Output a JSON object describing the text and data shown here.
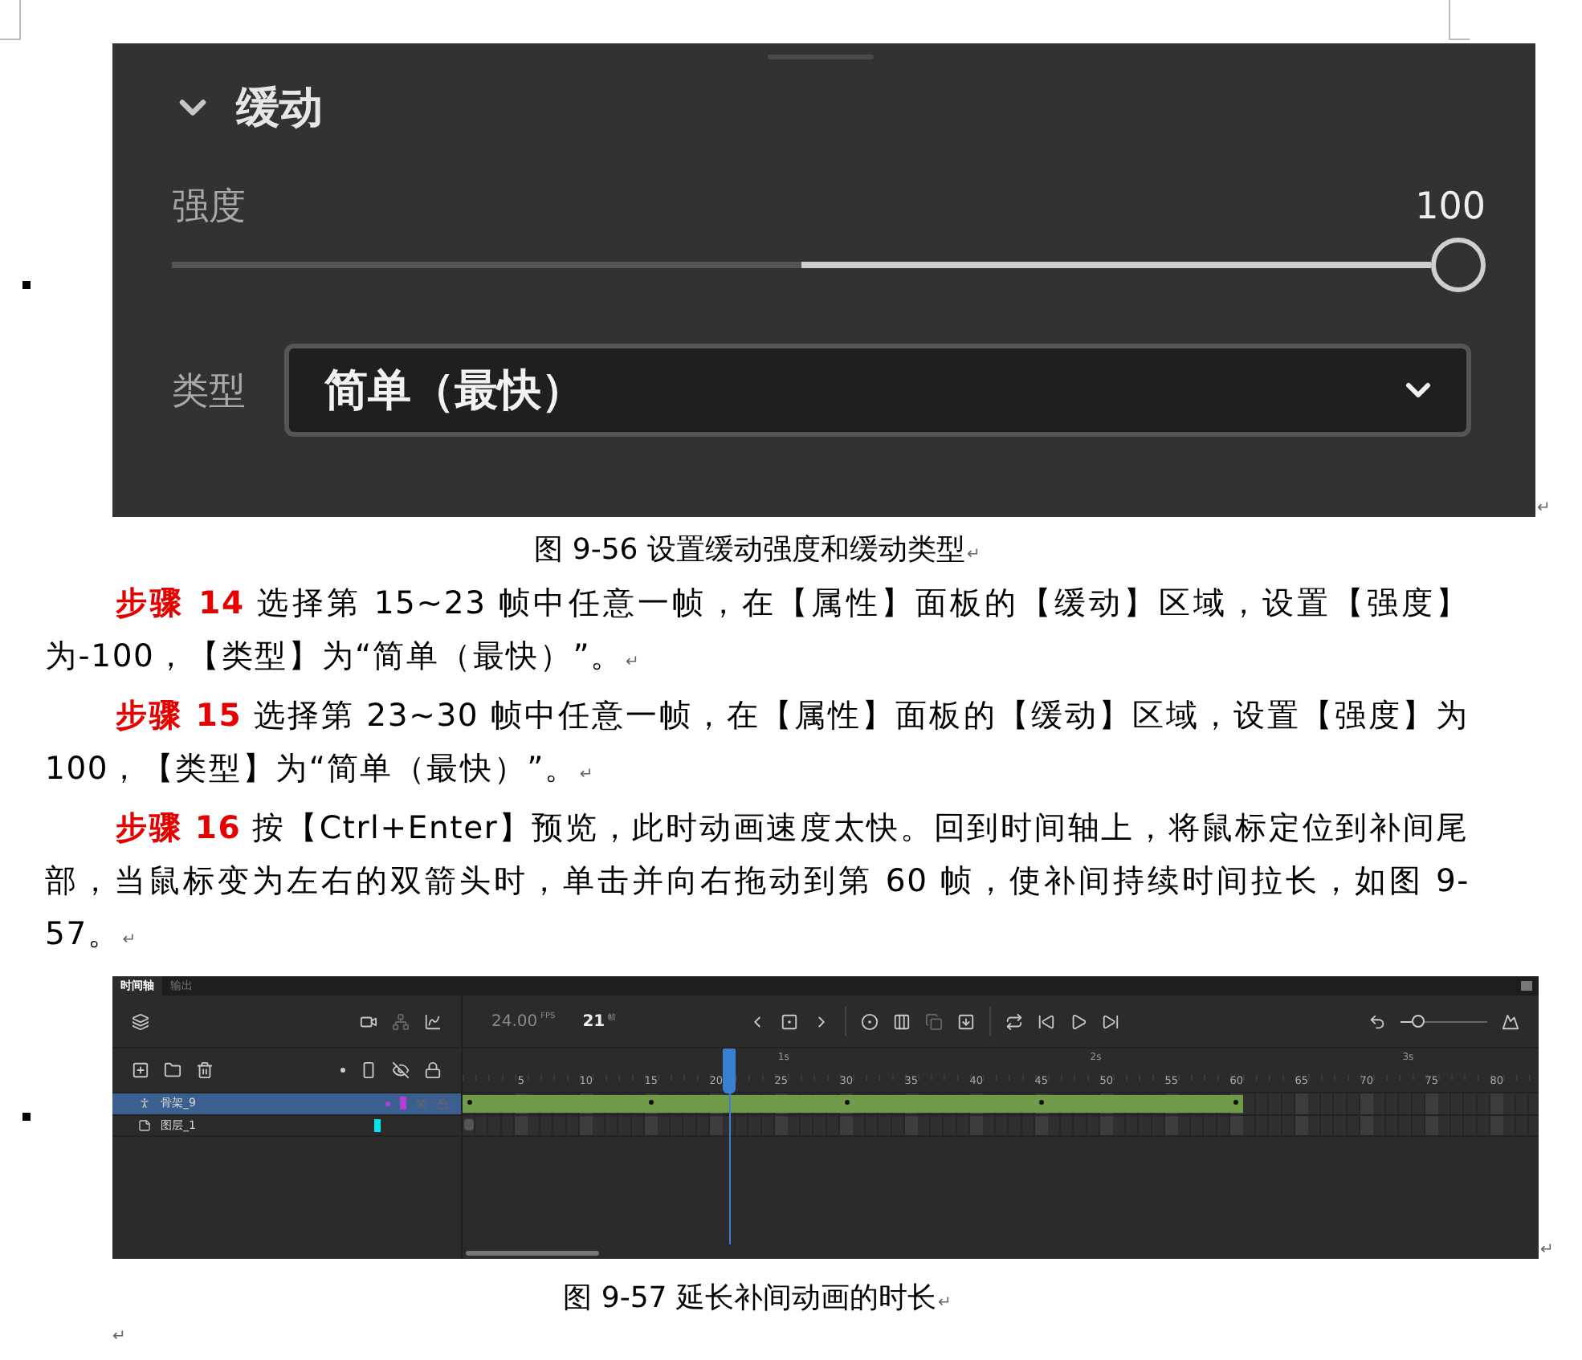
{
  "ease_panel": {
    "title": "缓动",
    "expanded": true,
    "strength": {
      "label": "强度",
      "value": "100",
      "level": 1
    },
    "type": {
      "label": "类型",
      "value": "简单（最快）"
    }
  },
  "caption_1": {
    "text": "图 9-56 设置缓动强度和缓动类型",
    "end_mark": "↵"
  },
  "steps": [
    {
      "step": "步骤 14",
      "text": " 选择第 15~23 帧中任意一帧，在【属性】面板的【缓动】区域，设置【强度】为-100，【类型】为“简单（最快）”。",
      "end_mark": "↵"
    },
    {
      "step": "步骤 15",
      "text": " 选择第 23~30 帧中任意一帧，在【属性】面板的【缓动】区域，设置【强度】为 100，【类型】为“简单（最快）”。",
      "end_mark": "↵"
    },
    {
      "step": "步骤  16",
      "text": " 按【Ctrl+Enter】预览，此时动画速度太快。回到时间轴上，将鼠标定位到补间尾部，当鼠标变为左右的双箭头时，单击并向右拖动到第 60 帧，使补间持续时间拉长，如图 9-57。",
      "end_mark": "↵"
    }
  ],
  "timeline": {
    "tabs": [
      {
        "label": "时间轴",
        "selected": true
      },
      {
        "label": "输出",
        "selected": false
      }
    ],
    "fps": "24.00",
    "fps_unit": "FPS",
    "current_frame": "21",
    "frame_unit": "帧",
    "seconds": [
      {
        "label": "1s"
      },
      {
        "label": "2s"
      },
      {
        "label": "3s"
      }
    ],
    "zoom": {
      "level": 0.15
    },
    "ruler": [
      "5",
      "10",
      "15",
      "20",
      "25",
      "30",
      "35",
      "40",
      "45",
      "50",
      "55",
      "60",
      "65",
      "70",
      "75",
      "80"
    ],
    "layers": [
      {
        "name": "骨架_9",
        "kind": "armature",
        "selected": true,
        "color": "#b03fd8"
      },
      {
        "name": "图层_1",
        "kind": "layer",
        "selected": false,
        "color": "#00e5ee"
      }
    ],
    "tween": {
      "level": 0.725,
      "keyframes": [
        {
          "level": 0.006
        },
        {
          "level": 0.175
        },
        {
          "level": 0.357
        },
        {
          "level": 0.538
        },
        {
          "level": 0.719
        }
      ]
    }
  },
  "caption_2": {
    "text": "图  9-57  延长补间动画的时长",
    "end_mark": "↵"
  },
  "final_mark": "↵"
}
